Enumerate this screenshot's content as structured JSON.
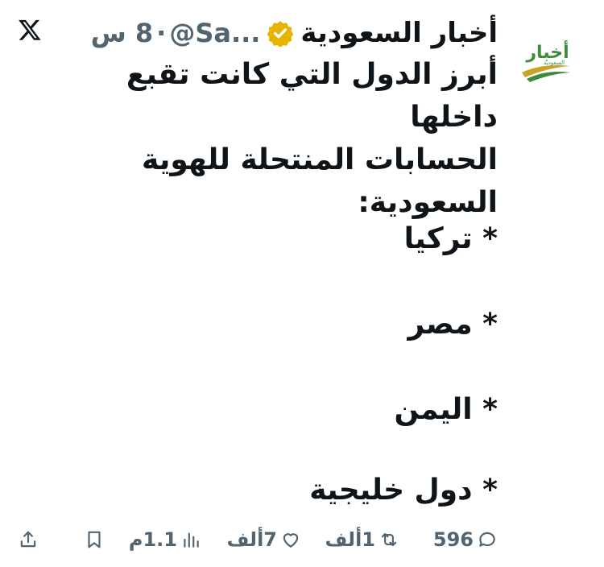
{
  "author": {
    "display_name": "أخبار السعودية",
    "handle": "@Sa...",
    "time": "8 س",
    "separator": "·",
    "verified": true,
    "verified_color": "#e8b400",
    "avatar_logo_text": "أخبار",
    "avatar_logo_subtext": "السعودية"
  },
  "tweet": {
    "lines": [
      "أبرز الدول التي كانت تقبع داخلها",
      "الحسابات المنتحلة للهوية",
      "السعودية:"
    ],
    "bullets": [
      "* تركيا",
      "* مصر",
      "* اليمن",
      "* دول خليجية"
    ]
  },
  "stats": {
    "replies": "596",
    "retweets": "1ألف",
    "likes": "7ألف",
    "views": "1.1م"
  },
  "colors": {
    "text": "#0f1419",
    "muted": "#536471",
    "logo_green": "#3d8b3d",
    "logo_gold": "#c9a227"
  },
  "icons": {
    "platform": "x-logo-icon",
    "reply": "speech-bubble-icon",
    "retweet": "retweet-icon",
    "like": "heart-icon",
    "views": "bar-chart-icon",
    "bookmark": "bookmark-icon",
    "share": "share-upload-icon"
  }
}
